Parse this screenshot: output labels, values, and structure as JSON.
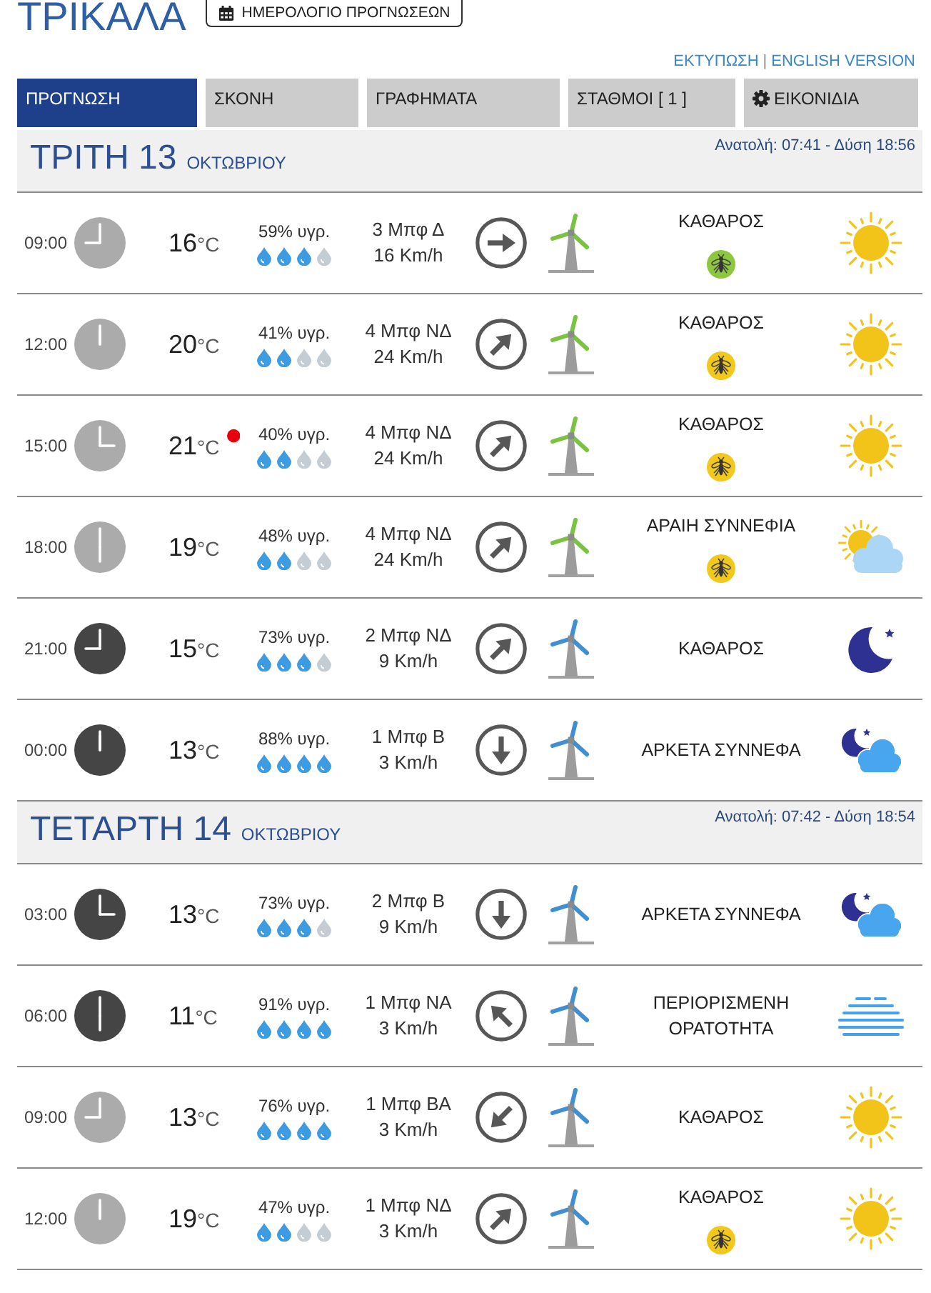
{
  "header": {
    "title": "ΤΡΙΚΑΛΑ",
    "calendar_button": "ΗΜΕΡΟΛΟΓΙΟ ΠΡΟΓΝΩΣΕΩΝ"
  },
  "links": {
    "print": "ΕΚΤΥΠΩΣΗ",
    "separator": "|",
    "english": "ENGLISH VERSION"
  },
  "tabs": [
    {
      "label": "ΠΡΟΓΝΩΣΗ",
      "selected": true,
      "kind": "text"
    },
    {
      "label": "ΣΚΟΝΗ",
      "selected": false,
      "kind": "text"
    },
    {
      "label": "ΓΡΑΦΗΜΑΤΑ",
      "selected": false,
      "kind": "text"
    },
    {
      "label": "ΣΤΑΘΜΟΙ [ 1 ]",
      "selected": false,
      "kind": "text"
    },
    {
      "label": "ΕΙΚΟΝΙΔΙΑ",
      "selected": false,
      "kind": "gear"
    }
  ],
  "days": [
    {
      "name": "ΤΡΙΤΗ 13",
      "month": "ΟΚΤΩΒΡΙΟΥ",
      "sun": "Ανατολή: 07:41 - Δύση 18:56",
      "rows": [
        {
          "time": "09:00",
          "night": false,
          "temp": "16",
          "unit": "°C",
          "max": false,
          "humidity": "59% υγρ.",
          "stars": 3,
          "wind": "3 Μπφ Δ",
          "speed": "16 Km/h",
          "arrow": {
            "kind": "e"
          },
          "turbine": {
            "color": "#7cc242"
          },
          "condition": "ΚΑΘΑΡΟΣ",
          "mosquito": {
            "color": "#8dc63f"
          },
          "weather": {
            "kind": "sun"
          }
        },
        {
          "time": "12:00",
          "night": false,
          "temp": "20",
          "unit": "°C",
          "max": false,
          "humidity": "41% υγρ.",
          "stars": 2,
          "wind": "4 Μπφ ΝΔ",
          "speed": "24 Km/h",
          "arrow": {
            "kind": "ne"
          },
          "turbine": {
            "color": "#7cc242"
          },
          "condition": "ΚΑΘΑΡΟΣ",
          "mosquito": {
            "color": "#f2c81d"
          },
          "weather": {
            "kind": "sun"
          }
        },
        {
          "time": "15:00",
          "night": false,
          "temp": "21",
          "unit": "°C",
          "max": true,
          "humidity": "40% υγρ.",
          "stars": 2,
          "wind": "4 Μπφ ΝΔ",
          "speed": "24 Km/h",
          "arrow": {
            "kind": "ne"
          },
          "turbine": {
            "color": "#7cc242"
          },
          "condition": "ΚΑΘΑΡΟΣ",
          "mosquito": {
            "color": "#f2c81d"
          },
          "weather": {
            "kind": "sun"
          }
        },
        {
          "time": "18:00",
          "night": false,
          "temp": "19",
          "unit": "°C",
          "max": false,
          "humidity": "48% υγρ.",
          "stars": 2,
          "wind": "4 Μπφ ΝΔ",
          "speed": "24 Km/h",
          "arrow": {
            "kind": "ne"
          },
          "turbine": {
            "color": "#7cc242"
          },
          "condition": "ΑΡΑΙΗ ΣΥΝΝΕΦΙΑ",
          "mosquito": {
            "color": "#f2c81d"
          },
          "weather": {
            "kind": "sun-cloud"
          }
        },
        {
          "time": "21:00",
          "night": true,
          "temp": "15",
          "unit": "°C",
          "max": false,
          "humidity": "73% υγρ.",
          "stars": 3,
          "wind": "2 Μπφ ΝΔ",
          "speed": "9 Km/h",
          "arrow": {
            "kind": "ne"
          },
          "turbine": {
            "color": "#3f8fd2"
          },
          "condition": "ΚΑΘΑΡΟΣ",
          "weather": {
            "kind": "moon"
          }
        },
        {
          "time": "00:00",
          "night": true,
          "temp": "13",
          "unit": "°C",
          "max": false,
          "humidity": "88% υγρ.",
          "stars": 4,
          "wind": "1 Μπφ Β",
          "speed": "3 Km/h",
          "arrow": {
            "kind": "s"
          },
          "turbine": {
            "color": "#3f8fd2"
          },
          "condition": "ΑΡΚΕΤΑ ΣΥΝΝΕΦΑ",
          "weather": {
            "kind": "moon-cloud"
          }
        }
      ]
    },
    {
      "name": "ΤΕΤΑΡΤΗ 14",
      "month": "ΟΚΤΩΒΡΙΟΥ",
      "sun": "Ανατολή: 07:42 - Δύση 18:54",
      "rows": [
        {
          "time": "03:00",
          "night": true,
          "temp": "13",
          "unit": "°C",
          "max": false,
          "humidity": "73% υγρ.",
          "stars": 3,
          "wind": "2 Μπφ Β",
          "speed": "9 Km/h",
          "arrow": {
            "kind": "s"
          },
          "turbine": {
            "color": "#3f8fd2"
          },
          "condition": "ΑΡΚΕΤΑ ΣΥΝΝΕΦΑ",
          "weather": {
            "kind": "moon-cloud"
          }
        },
        {
          "time": "06:00",
          "night": true,
          "temp": "11",
          "unit": "°C",
          "max": false,
          "humidity": "91% υγρ.",
          "stars": 4,
          "wind": "1 Μπφ ΝΑ",
          "speed": "3 Km/h",
          "arrow": {
            "kind": "nw"
          },
          "turbine": {
            "color": "#3f8fd2"
          },
          "condition": "ΠΕΡΙΟΡΙΣΜΕΝΗ ΟΡΑΤΟΤΗΤΑ",
          "weather": {
            "kind": "fog"
          }
        },
        {
          "time": "09:00",
          "night": false,
          "temp": "13",
          "unit": "°C",
          "max": false,
          "humidity": "76% υγρ.",
          "stars": 4,
          "wind": "1 Μπφ ΒΑ",
          "speed": "3 Km/h",
          "arrow": {
            "kind": "sw"
          },
          "turbine": {
            "color": "#3f8fd2"
          },
          "condition": "ΚΑΘΑΡΟΣ",
          "weather": {
            "kind": "sun"
          }
        },
        {
          "time": "12:00",
          "night": false,
          "temp": "19",
          "unit": "°C",
          "max": false,
          "humidity": "47% υγρ.",
          "stars": 2,
          "wind": "1 Μπφ ΝΔ",
          "speed": "3 Km/h",
          "arrow": {
            "kind": "ne"
          },
          "turbine": {
            "color": "#3f8fd2"
          },
          "condition": "ΚΑΘΑΡΟΣ",
          "mosquito": {
            "color": "#f2c81d"
          },
          "weather": {
            "kind": "sun"
          }
        }
      ]
    }
  ]
}
